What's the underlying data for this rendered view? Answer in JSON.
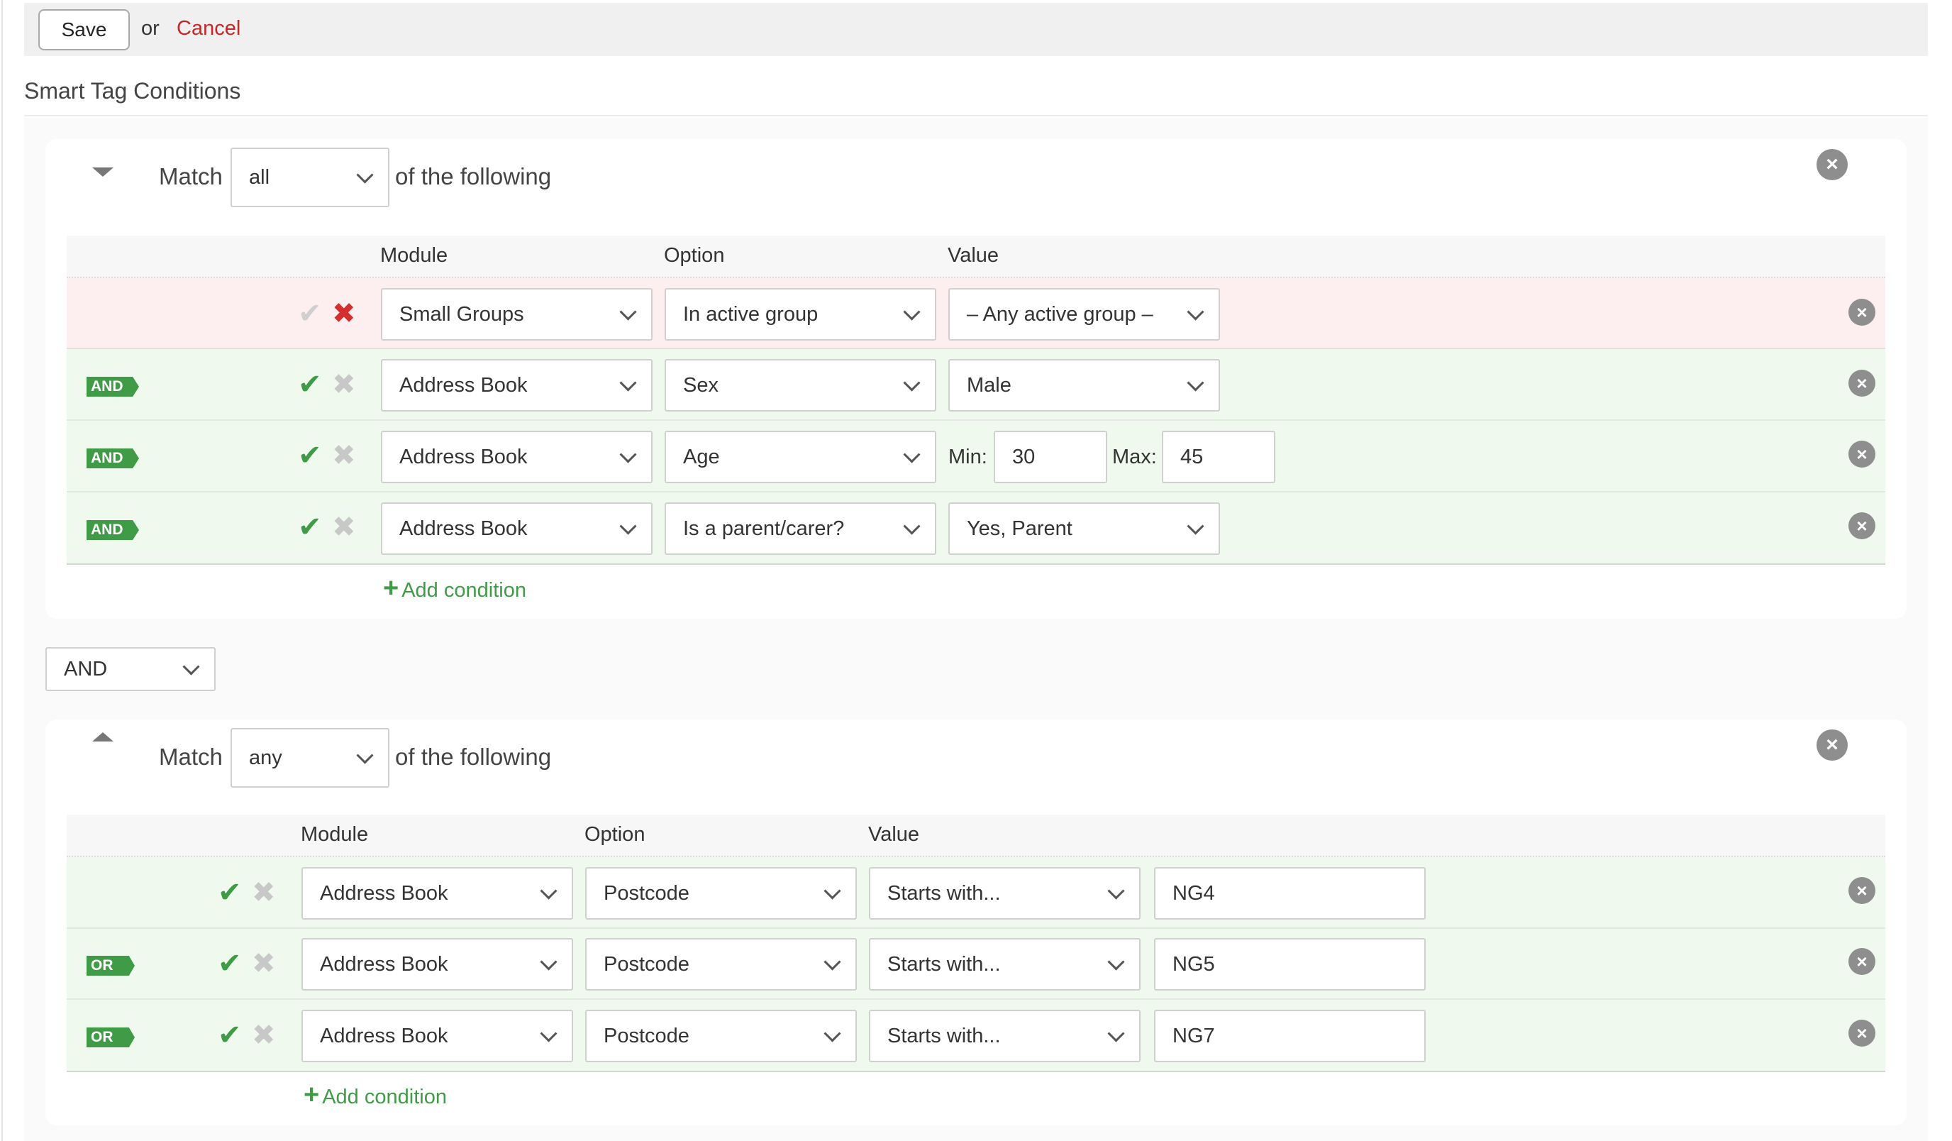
{
  "toolbar": {
    "save_label": "Save",
    "or_text": "or",
    "cancel_label": "Cancel"
  },
  "section": {
    "title": "Smart Tag Conditions"
  },
  "group1": {
    "match_label": "Match",
    "match_value": "all",
    "following": "of the following",
    "headers": {
      "module": "Module",
      "option": "Option",
      "value": "Value"
    },
    "rows": [
      {
        "connector": "",
        "valid": false,
        "module": "Small Groups",
        "option": "In active group",
        "value": "– Any active group –"
      },
      {
        "connector": "AND",
        "valid": true,
        "module": "Address Book",
        "option": "Sex",
        "value": "Male"
      },
      {
        "connector": "AND",
        "valid": true,
        "module": "Address Book",
        "option": "Age",
        "min_label": "Min:",
        "min": "30",
        "max_label": "Max:",
        "max": "45"
      },
      {
        "connector": "AND",
        "valid": true,
        "module": "Address Book",
        "option": "Is a parent/carer?",
        "value": "Yes, Parent"
      }
    ],
    "add_condition": "Add condition"
  },
  "between": {
    "value": "AND"
  },
  "group2": {
    "match_label": "Match",
    "match_value": "any",
    "following": "of the following",
    "headers": {
      "module": "Module",
      "option": "Option",
      "value": "Value"
    },
    "rows": [
      {
        "connector": "",
        "valid": true,
        "module": "Address Book",
        "option": "Postcode",
        "value": "Starts with...",
        "text": "NG4"
      },
      {
        "connector": "OR",
        "valid": true,
        "module": "Address Book",
        "option": "Postcode",
        "value": "Starts with...",
        "text": "NG5"
      },
      {
        "connector": "OR",
        "valid": true,
        "module": "Address Book",
        "option": "Postcode",
        "value": "Starts with...",
        "text": "NG7"
      }
    ],
    "add_condition": "Add condition"
  },
  "icons": {
    "check": "✔",
    "cross": "✖",
    "close": "×",
    "plus": "+"
  },
  "colors": {
    "green": "#3f9b46",
    "red": "#d32f2f",
    "cancel": "#c62828"
  }
}
